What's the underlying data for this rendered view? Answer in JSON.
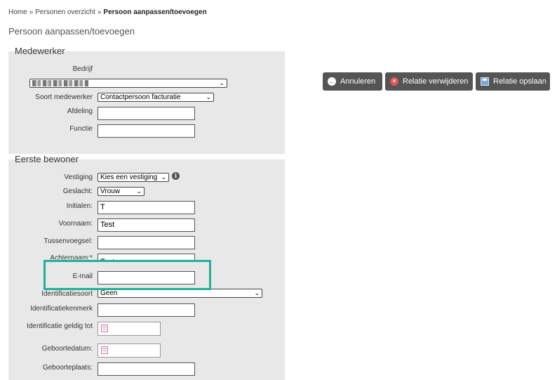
{
  "breadcrumb": {
    "home": "Home",
    "separator": "»",
    "overview": "Personen overzicht",
    "current": "Persoon aanpassen/toevoegen"
  },
  "page_title": "Persoon aanpassen/toevoegen",
  "medewerker": {
    "legend": "Medewerker",
    "bedrijf_label": "Bedrijf",
    "soort_label": "Soort medewerker",
    "soort_value": "Contactpersoon facturatie",
    "afdeling_label": "Afdeling",
    "afdeling_value": "",
    "functie_label": "Functie",
    "functie_value": ""
  },
  "bewoner": {
    "legend": "Eerste bewoner",
    "vestiging_label": "Vestiging",
    "vestiging_value": "Kies een vestiging",
    "geslacht_label": "Geslacht:",
    "geslacht_value": "Vrouw",
    "initialen_label": "Initialen:",
    "initialen_value": "T",
    "voornaam_label": "Voornaam:",
    "voornaam_value": "Test",
    "tussenvoegsel_label": "Tussenvoegsel:",
    "tussenvoegsel_value": "",
    "achternaam_label": "Achternaam:*",
    "achternaam_value": "Testpersoon",
    "email_label": "E-mail",
    "email_value": "",
    "id_soort_label": "Identificatiesoort",
    "id_soort_value": "Geen",
    "id_kenmerk_label": "Identificatiekenmerk",
    "id_kenmerk_value": "",
    "id_geldig_label": "Identificatie geldig tot",
    "geboortedatum_label": "Geboortedatum:",
    "geboorteplaats_label": "Geboorteplaats:",
    "geboorteplaats_value": ""
  },
  "actions": {
    "cancel": "Annuleren",
    "delete": "Relatie verwijderen",
    "save": "Relatie opslaan"
  },
  "icons": {
    "cancel": "arrow-left-circle-icon",
    "delete": "close-circle-icon",
    "save": "floppy-disk-icon",
    "info": "info-icon",
    "calendar": "calendar-icon"
  },
  "colors": {
    "panel_bg": "#e8e8e8",
    "button_bg": "#555555",
    "highlight": "#1db39a",
    "delete_icon": "#e05555"
  }
}
